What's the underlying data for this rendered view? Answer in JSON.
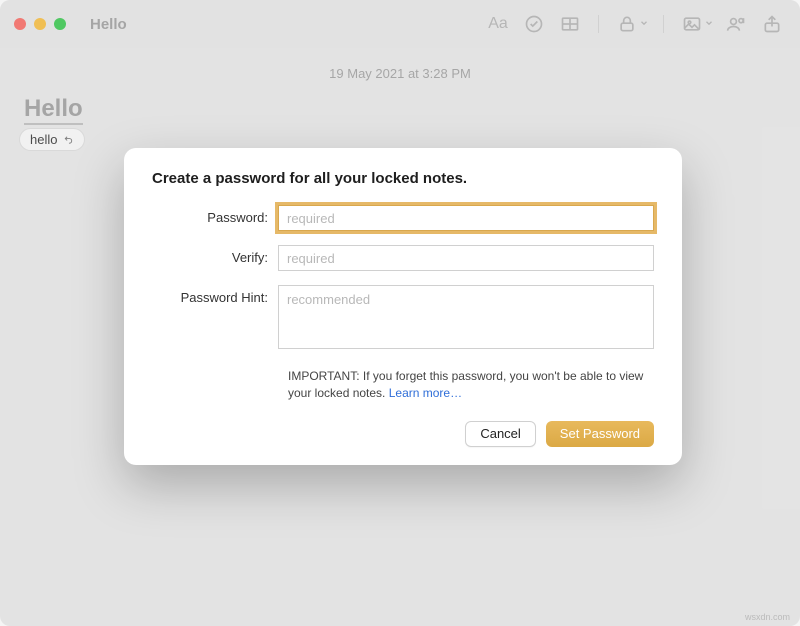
{
  "window": {
    "title": "Hello"
  },
  "note": {
    "date": "19 May 2021 at 3:28 PM",
    "title": "Hello",
    "suggestion": "hello"
  },
  "toolbar": {
    "icons": {
      "format": "Aa",
      "checklist": "checklist",
      "table": "table",
      "lock": "lock",
      "image": "image",
      "collaborate": "collaborate",
      "share": "share"
    }
  },
  "dialog": {
    "title": "Create a password for all your locked notes.",
    "labels": {
      "password": "Password:",
      "verify": "Verify:",
      "hint": "Password Hint:"
    },
    "placeholders": {
      "password": "required",
      "verify": "required",
      "hint": "recommended"
    },
    "important_prefix": "IMPORTANT: If you forget this password, you won't be able to view your locked notes. ",
    "learn_more": "Learn more…",
    "buttons": {
      "cancel": "Cancel",
      "set": "Set Password"
    }
  },
  "watermark": "wsxdn.com"
}
